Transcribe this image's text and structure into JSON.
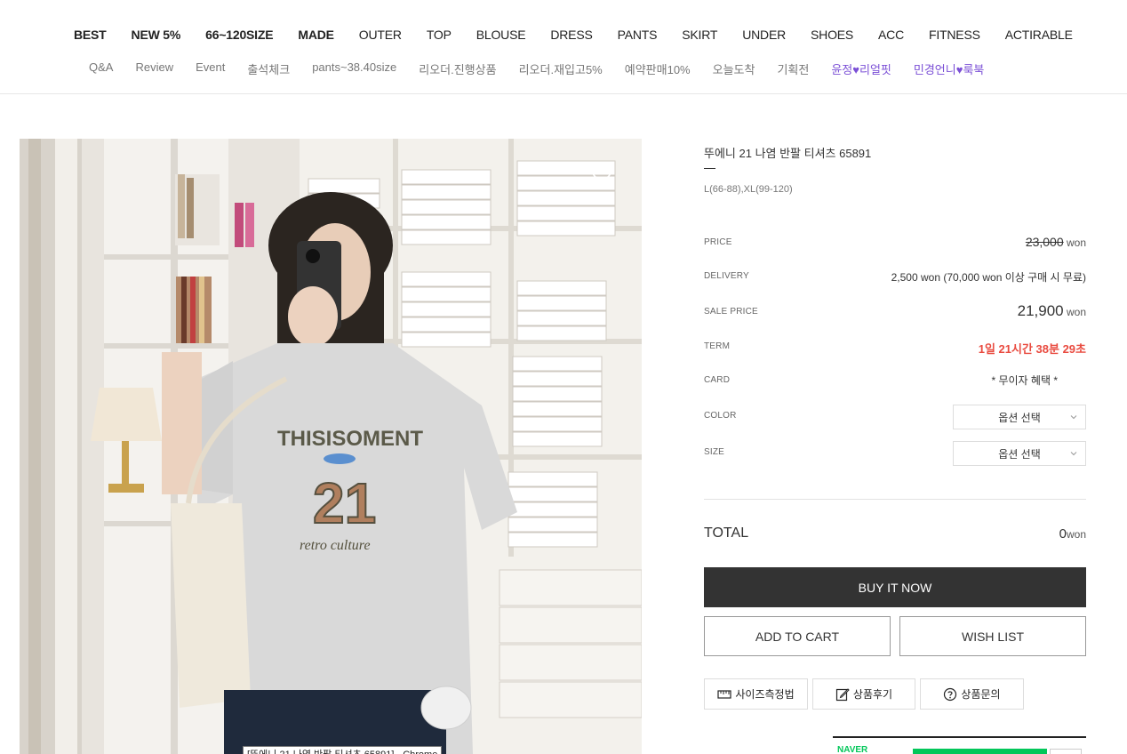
{
  "nav": {
    "main": [
      {
        "label": "BEST",
        "bold": true
      },
      {
        "label": "NEW 5%",
        "bold": true
      },
      {
        "label": "66~120SIZE",
        "bold": true
      },
      {
        "label": "MADE",
        "bold": true
      },
      {
        "label": "OUTER",
        "bold": false
      },
      {
        "label": "TOP",
        "bold": false
      },
      {
        "label": "BLOUSE",
        "bold": false
      },
      {
        "label": "DRESS",
        "bold": false
      },
      {
        "label": "PANTS",
        "bold": false
      },
      {
        "label": "SKIRT",
        "bold": false
      },
      {
        "label": "UNDER",
        "bold": false
      },
      {
        "label": "SHOES",
        "bold": false
      },
      {
        "label": "ACC",
        "bold": false
      },
      {
        "label": "FITNESS",
        "bold": false
      },
      {
        "label": "ACTIRABLE",
        "bold": false
      }
    ],
    "sub": [
      {
        "label": "Q&A"
      },
      {
        "label": "Review"
      },
      {
        "label": "Event"
      },
      {
        "label": "출석체크"
      },
      {
        "label": "pants~38.40size"
      },
      {
        "label": "리오더.진행상품"
      },
      {
        "label": "리오더.재입고5%"
      },
      {
        "label": "예약판매10%"
      },
      {
        "label": "오늘도착"
      },
      {
        "label": "기획전"
      },
      {
        "label_a": "윤정",
        "label_b": "리얼핏",
        "purple": true
      },
      {
        "label_a": "민경언니",
        "label_b": "룩북",
        "purple": true
      }
    ]
  },
  "product": {
    "title": "뚜에니 21 나염 반팔 티셔츠 65891",
    "sizes_note": "L(66-88),XL(99-120)",
    "image_tooltip": "[뚜에니 21 나염 반팔 티셔츠 65891] - Chrome"
  },
  "rows": {
    "price_label": "PRICE",
    "price_value": "23,000",
    "price_unit": "won",
    "delivery_label": "DELIVERY",
    "delivery_value": "2,500 won (70,000 won 이상 구매 시 무료)",
    "sale_label": "SALE PRICE",
    "sale_value": "21,900",
    "sale_unit": "won",
    "term_label": "TERM",
    "term_value": "1일 21시간 38분 29초",
    "card_label": "CARD",
    "card_value": "* 무이자 혜택 *",
    "color_label": "COLOR",
    "color_select": "옵션 선택",
    "size_label": "SIZE",
    "size_select": "옵션 선택"
  },
  "total": {
    "label": "TOTAL",
    "value": "0",
    "unit": "won"
  },
  "buttons": {
    "buy": "BUY IT NOW",
    "cart": "ADD TO CART",
    "wish": "WISH LIST",
    "size_guide": "사이즈측정법",
    "review": "상품후기",
    "inquiry": "상품문의"
  },
  "naver": {
    "logo": "NAVER"
  },
  "colors": {
    "accent_purple": "#7b4fd6",
    "term_red": "#e94a3f",
    "buy_bg": "#333333",
    "naver_green": "#03c75a"
  }
}
